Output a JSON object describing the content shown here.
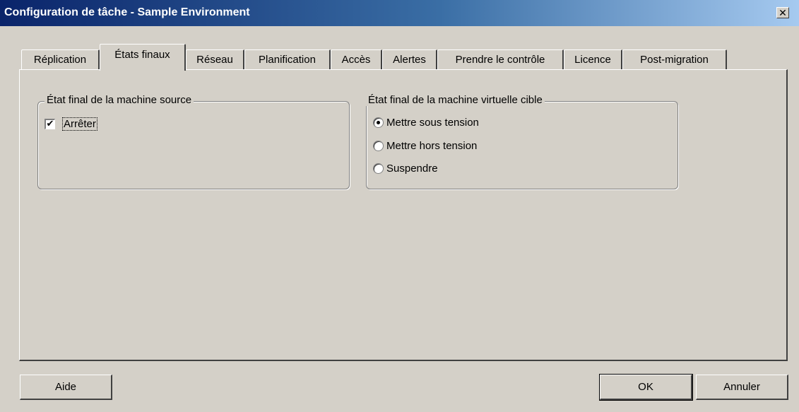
{
  "window": {
    "title": "Configuration de tâche - Sample Environment",
    "close_glyph": "✕"
  },
  "tabs": [
    {
      "label": "Réplication"
    },
    {
      "label": "États finaux"
    },
    {
      "label": "Réseau"
    },
    {
      "label": "Planification"
    },
    {
      "label": "Accès"
    },
    {
      "label": "Alertes"
    },
    {
      "label": "Prendre le contrôle"
    },
    {
      "label": "Licence"
    },
    {
      "label": "Post-migration"
    }
  ],
  "active_tab": "États finaux",
  "source_group": {
    "legend": "État final de la machine source",
    "checkbox": {
      "label": "Arrêter",
      "checked": true,
      "check_glyph": "✔"
    }
  },
  "target_group": {
    "legend": "État final de la machine virtuelle cible",
    "options": [
      {
        "label": "Mettre sous tension",
        "selected": true
      },
      {
        "label": "Mettre hors tension",
        "selected": false
      },
      {
        "label": "Suspendre",
        "selected": false
      }
    ]
  },
  "buttons": {
    "help": "Aide",
    "ok": "OK",
    "cancel": "Annuler"
  },
  "colors": {
    "titlebar_start": "#0a246a",
    "titlebar_end": "#a6caf0",
    "face": "#d4d0c8"
  }
}
